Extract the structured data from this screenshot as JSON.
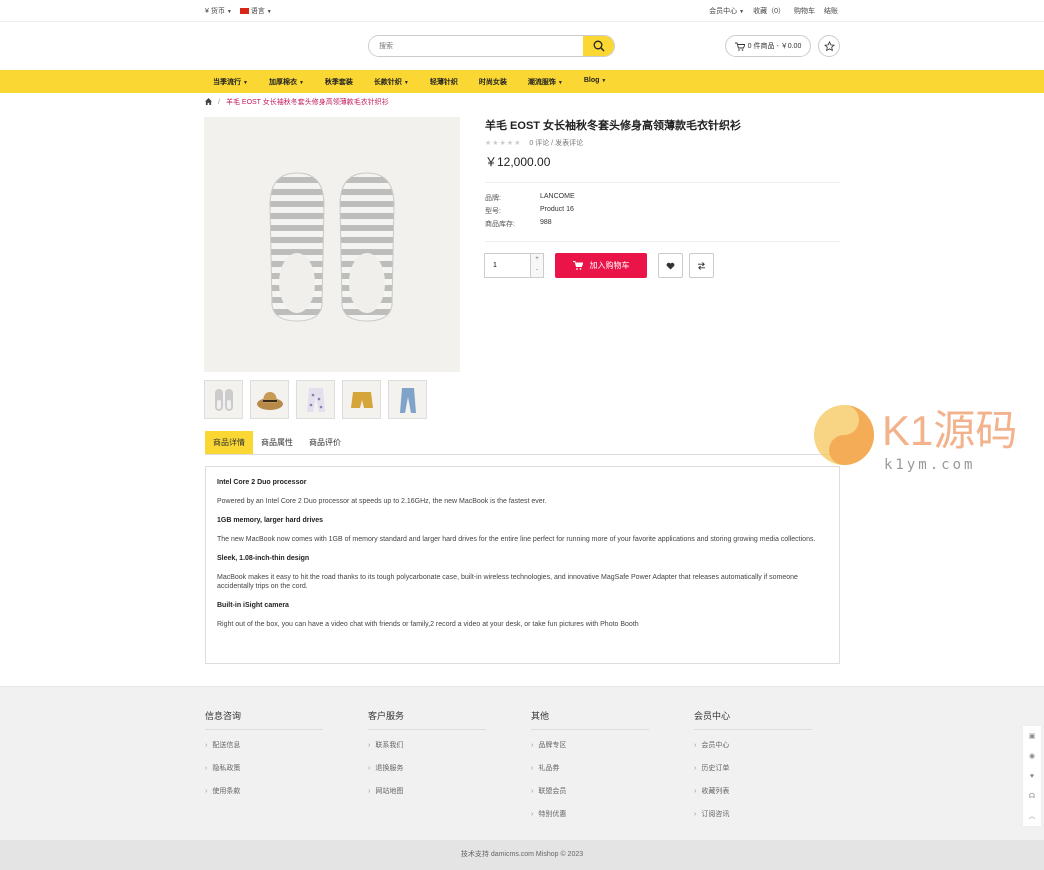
{
  "topbar": {
    "currency": "¥ 货币",
    "language": "语言",
    "member_center": "会员中心",
    "favorites": "收藏（0）",
    "cart": "购物车",
    "checkout": "结账"
  },
  "search": {
    "placeholder": "搜索"
  },
  "header_cart": {
    "label": "0 件商品 - ￥0.00"
  },
  "nav": {
    "items": [
      "当季流行",
      "加厚棉衣",
      "秋季套装",
      "长款针织",
      "轻薄针织",
      "时尚女装",
      "潮流服饰",
      "Blog"
    ],
    "has_caret": [
      true,
      true,
      false,
      true,
      false,
      false,
      true,
      true
    ]
  },
  "breadcrumb": {
    "current": "羊毛 EOST 女长袖秋冬套头修身高领薄款毛衣针织衫"
  },
  "product": {
    "title": "羊毛 EOST 女长袖秋冬套头修身高领薄款毛衣针织衫",
    "reviews": "0 评论 / 发表评论",
    "price": "￥12,000.00",
    "rating_stars": 0,
    "brand_label": "品牌:",
    "brand": "LANCOME",
    "model_label": "型号:",
    "model": "Product 16",
    "stock_label": "商品库存:",
    "stock": "988",
    "quantity": "1",
    "add_to_cart": "加入购物车"
  },
  "tabs": [
    "商品详情",
    "商品属性",
    "商品评价"
  ],
  "description": {
    "sections": [
      {
        "heading": "Intel Core 2 Duo processor",
        "text": "Powered by an Intel Core 2 Duo processor at speeds up to 2.16GHz, the new MacBook is the fastest ever."
      },
      {
        "heading": "1GB memory, larger hard drives",
        "text": "The new MacBook now comes with 1GB of memory standard and larger hard drives for the entire line perfect for running more of your favorite applications and storing growing media collections."
      },
      {
        "heading": "Sleek, 1.08-inch-thin design",
        "text": "MacBook makes it easy to hit the road thanks to its tough polycarbonate case, built-in wireless technologies, and innovative MagSafe Power Adapter that releases automatically if someone accidentally trips on the cord."
      },
      {
        "heading": "Built-in iSight camera",
        "text": "Right out of the box, you can have a video chat with friends or family,2 record a video at your desk, or take fun pictures with Photo Booth"
      }
    ]
  },
  "footer": {
    "columns": [
      {
        "title": "信息咨询",
        "links": [
          "配送信息",
          "隐私政策",
          "使用条款"
        ]
      },
      {
        "title": "客户服务",
        "links": [
          "联系我们",
          "退换服务",
          "网站地图"
        ]
      },
      {
        "title": "其他",
        "links": [
          "品牌专区",
          "礼品券",
          "联盟会员",
          "特别优惠"
        ]
      },
      {
        "title": "会员中心",
        "links": [
          "会员中心",
          "历史订单",
          "收藏列表",
          "订阅咨讯"
        ]
      }
    ],
    "copyright": "技术支持 damicms.com Mishop © 2023"
  },
  "watermark": {
    "brand": "K1源码",
    "domain": "k1ym.com"
  },
  "colors": {
    "accent": "#fad732",
    "cart_button": "#ea1448",
    "breadcrumb_current": "#c2185b"
  }
}
